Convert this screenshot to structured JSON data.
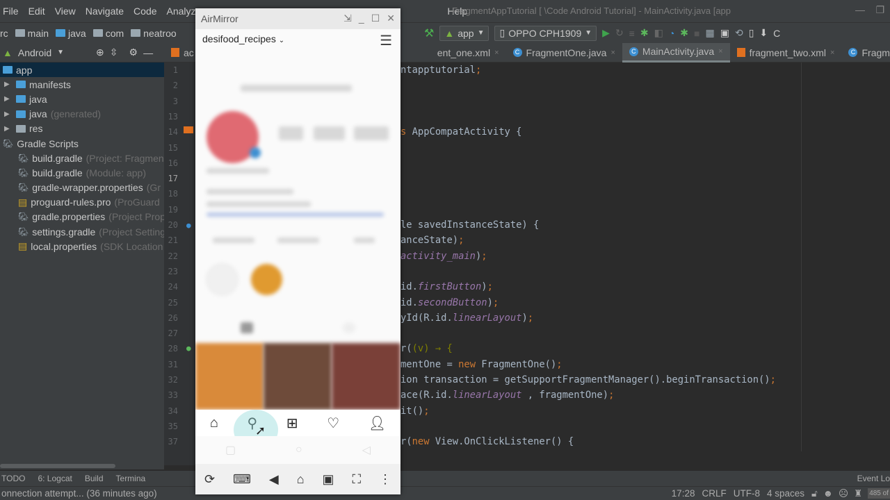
{
  "menu": [
    "File",
    "Edit",
    "View",
    "Navigate",
    "Code",
    "Analyze",
    "Help"
  ],
  "window_title": "FragmentAppTutorial [ \\Code Android Tutorial] - MainActivity.java [app",
  "breadcrumb": [
    "rc",
    "main",
    "java",
    "com",
    "neatroo"
  ],
  "toolbar": {
    "run_config": "app",
    "device": "OPPO CPH1909",
    "extra": "C"
  },
  "project": {
    "view": "Android",
    "tree": [
      {
        "label": "app",
        "hint": "",
        "level": 0,
        "selected": true
      },
      {
        "label": "manifests",
        "hint": "",
        "level": 1
      },
      {
        "label": "java",
        "hint": "",
        "level": 1
      },
      {
        "label": "java",
        "hint": "(generated)",
        "level": 1
      },
      {
        "label": "res",
        "hint": "",
        "level": 1
      },
      {
        "label": "Gradle Scripts",
        "hint": "",
        "level": 0
      },
      {
        "label": "build.gradle",
        "hint": "(Project: Fragmen",
        "level": 2
      },
      {
        "label": "build.gradle",
        "hint": "(Module: app)",
        "level": 2
      },
      {
        "label": "gradle-wrapper.properties",
        "hint": "(Gr",
        "level": 2
      },
      {
        "label": "proguard-rules.pro",
        "hint": "(ProGuard",
        "level": 2
      },
      {
        "label": "gradle.properties",
        "hint": "(Project Prop",
        "level": 2
      },
      {
        "label": "settings.gradle",
        "hint": "(Project Setting",
        "level": 2
      },
      {
        "label": "local.properties",
        "hint": "(SDK Location",
        "level": 2
      }
    ]
  },
  "tabs": [
    {
      "label": "ac",
      "active": false
    },
    {
      "label": "ent_one.xml",
      "active": false
    },
    {
      "label": "FragmentOne.java",
      "active": false
    },
    {
      "label": "MainActivity.java",
      "active": true
    },
    {
      "label": "fragment_two.xml",
      "active": false
    },
    {
      "label": "Fragmer",
      "active": false
    }
  ],
  "line_numbers": [
    "1",
    "2",
    "3",
    "13",
    "14",
    "15",
    "16",
    "17",
    "18",
    "19",
    "20",
    "21",
    "22",
    "23",
    "24",
    "25",
    "26",
    "27",
    "28",
    "31",
    "32",
    "33",
    "34",
    "35",
    "37"
  ],
  "code": [
    {
      "line": "1",
      "parts": [
        [
          "ntapptutorial",
          ""
        ],
        [
          ";",
          "kw"
        ]
      ]
    },
    {
      "line": "14",
      "parts": [
        [
          "s",
          "kw"
        ],
        [
          " AppCompatActivity {",
          ""
        ]
      ]
    },
    {
      "line": "20",
      "parts": [
        [
          "le savedInstanceState) {",
          ""
        ]
      ]
    },
    {
      "line": "21",
      "parts": [
        [
          "anceState)",
          ""
        ],
        [
          ";",
          "kw"
        ]
      ]
    },
    {
      "line": "22",
      "parts": [
        [
          "activity_main",
          "it"
        ],
        [
          ")",
          ""
        ],
        [
          ";",
          "kw"
        ]
      ]
    },
    {
      "line": "24",
      "parts": [
        [
          "id.",
          ""
        ],
        [
          "firstButton",
          "it"
        ],
        [
          ")",
          ""
        ],
        [
          ";",
          "kw"
        ]
      ]
    },
    {
      "line": "25",
      "parts": [
        [
          "id.",
          ""
        ],
        [
          "secondButton",
          "it"
        ],
        [
          ")",
          ""
        ],
        [
          ";",
          "kw"
        ]
      ]
    },
    {
      "line": "26",
      "parts": [
        [
          "yId(R.id.",
          ""
        ],
        [
          "linearLayout",
          "it"
        ],
        [
          ")",
          ""
        ],
        [
          ";",
          "kw"
        ]
      ]
    },
    {
      "line": "28",
      "parts": [
        [
          "r(",
          ""
        ],
        [
          "(v) → {",
          "lam"
        ]
      ]
    },
    {
      "line": "31",
      "parts": [
        [
          "mentOne = ",
          ""
        ],
        [
          "new",
          "kw"
        ],
        [
          " FragmentOne()",
          ""
        ],
        [
          ";",
          "kw"
        ]
      ]
    },
    {
      "line": "32",
      "parts": [
        [
          "ion transaction = getSupportFragmentManager().beginTransaction()",
          ""
        ],
        [
          ";",
          "kw"
        ]
      ]
    },
    {
      "line": "33",
      "parts": [
        [
          "ace(R.id.",
          ""
        ],
        [
          "linearLayout",
          "it"
        ],
        [
          " , fragmentOne)",
          ""
        ],
        [
          ";",
          "kw"
        ]
      ]
    },
    {
      "line": "34",
      "parts": [
        [
          "it()",
          ""
        ],
        [
          ";",
          "kw"
        ]
      ]
    },
    {
      "line": "37",
      "parts": [
        [
          "r(",
          ""
        ],
        [
          "new",
          "kw"
        ],
        [
          " View.OnClickListener() {",
          ""
        ]
      ]
    }
  ],
  "bottom_tools": [
    "TODO",
    "6: Logcat",
    "Build",
    "Termina",
    "Event Lo"
  ],
  "status": {
    "message": "onnection attempt... (36 minutes ago)",
    "position": "17:28",
    "line_sep": "CRLF",
    "encoding": "UTF-8",
    "indent": "4 spaces",
    "memory": "485 of"
  },
  "airmirror": {
    "title": "AirMirror",
    "account": "desifood_recipes",
    "bottom_nav": [
      "home-icon",
      "search-icon",
      "add-post-icon",
      "heart-icon",
      "profile-icon"
    ]
  },
  "colors": {
    "accent": "#3d8fd1",
    "keyword": "#cc7832",
    "field": "#9876aa"
  }
}
